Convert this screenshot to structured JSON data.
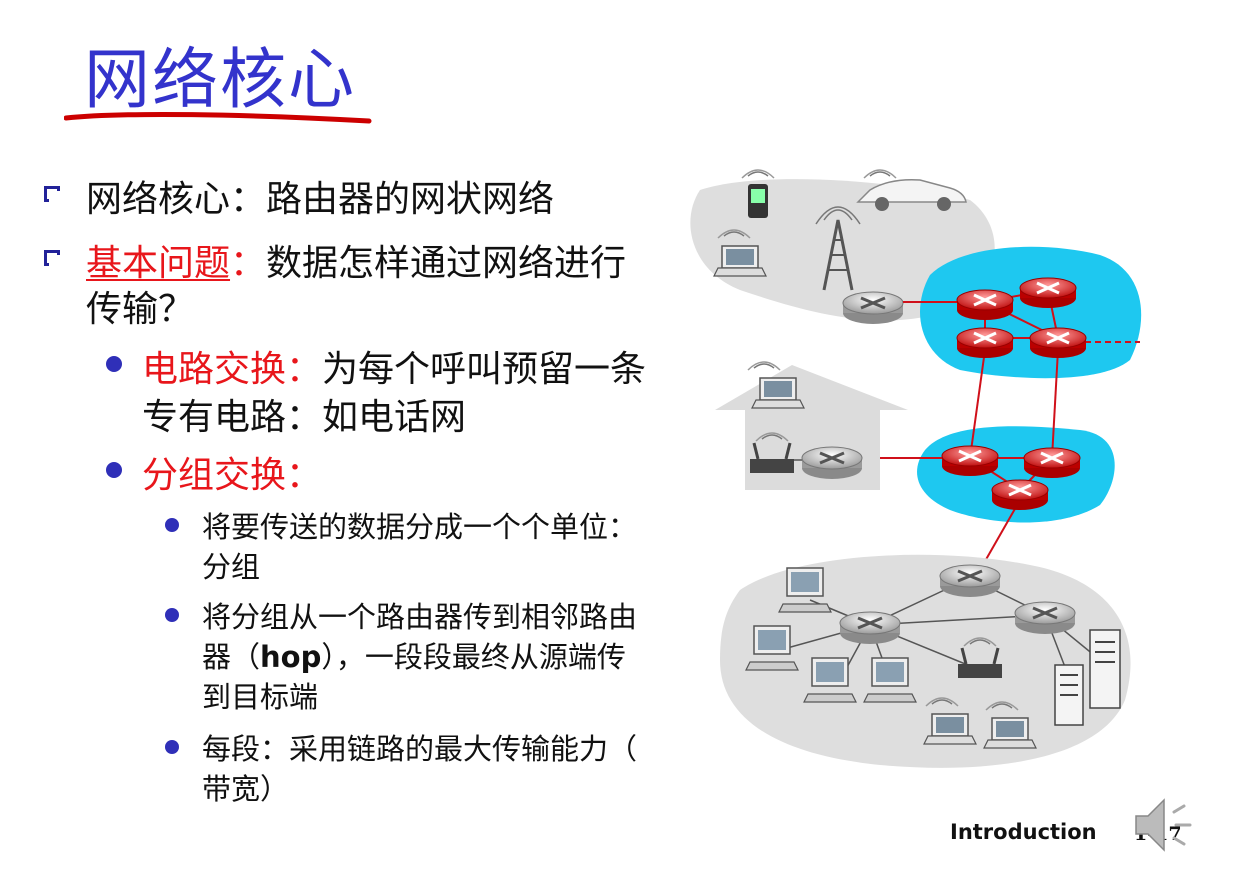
{
  "slide": {
    "title": "网络核心",
    "bullets": {
      "b1": "网络核心：路由器的网状网络",
      "b2_keyword": "基本问题",
      "b2_colon": "：",
      "b2_rest_line1": "数据怎样通过网络进行",
      "b2_rest_line2": "传输？",
      "sub1_keyword": "电路交换：",
      "sub1_rest_line1": "为每个呼叫预留一条",
      "sub1_rest_line2": "专有电路：如电话网",
      "sub2_keyword": "分组交换：",
      "sub2a_line1": "将要传送的数据分成一个个单位：",
      "sub2a_line2": "分组",
      "sub2b_line1": "将分组从一个路由器传到相邻路由",
      "sub2b_line2_pre": "器（",
      "sub2b_line2_hop": "hop",
      "sub2b_line2_post": "），一段段最终从源端传",
      "sub2b_line3": "到目标端",
      "sub2c_line1": "每段：采用链路的最大传输能力（",
      "sub2c_line2": "带宽）"
    },
    "footer": {
      "label": "Introduction",
      "page": "1-17"
    }
  },
  "colors": {
    "title": "#3333cc",
    "keyword_red": "#e8161b",
    "bullet_blue": "#2f2fb8",
    "network_core_cyan": "#1ec8f0",
    "access_gray": "#dcdcdc",
    "link_red": "#d0101a"
  },
  "icons": [
    "router-icon",
    "laptop-icon",
    "phone-icon",
    "car-icon",
    "tower-icon",
    "house-icon",
    "wireless-router-icon",
    "desktop-icon",
    "server-icon",
    "speaker-icon"
  ]
}
